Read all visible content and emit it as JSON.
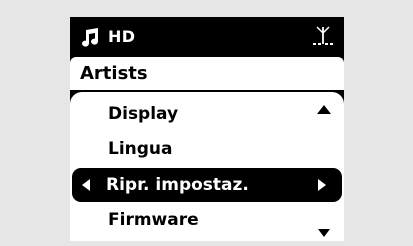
{
  "status": {
    "source": "HD",
    "left_icon": "music-note-icon",
    "right_icon": "antenna-signal-icon"
  },
  "header": {
    "title": "Artists"
  },
  "menu": {
    "items": [
      {
        "label": "Display",
        "selected": false
      },
      {
        "label": "Lingua",
        "selected": false
      },
      {
        "label": "Ripr. impostaz.",
        "selected": true
      },
      {
        "label": "Firmware",
        "selected": false
      }
    ],
    "scroll_up_icon": "triangle-up-icon",
    "scroll_down_icon": "triangle-down-icon"
  },
  "colors": {
    "screen_background": "#000000",
    "panel_background": "#ffffff",
    "highlight": "#000000",
    "page_background": "#e6e6e6"
  }
}
